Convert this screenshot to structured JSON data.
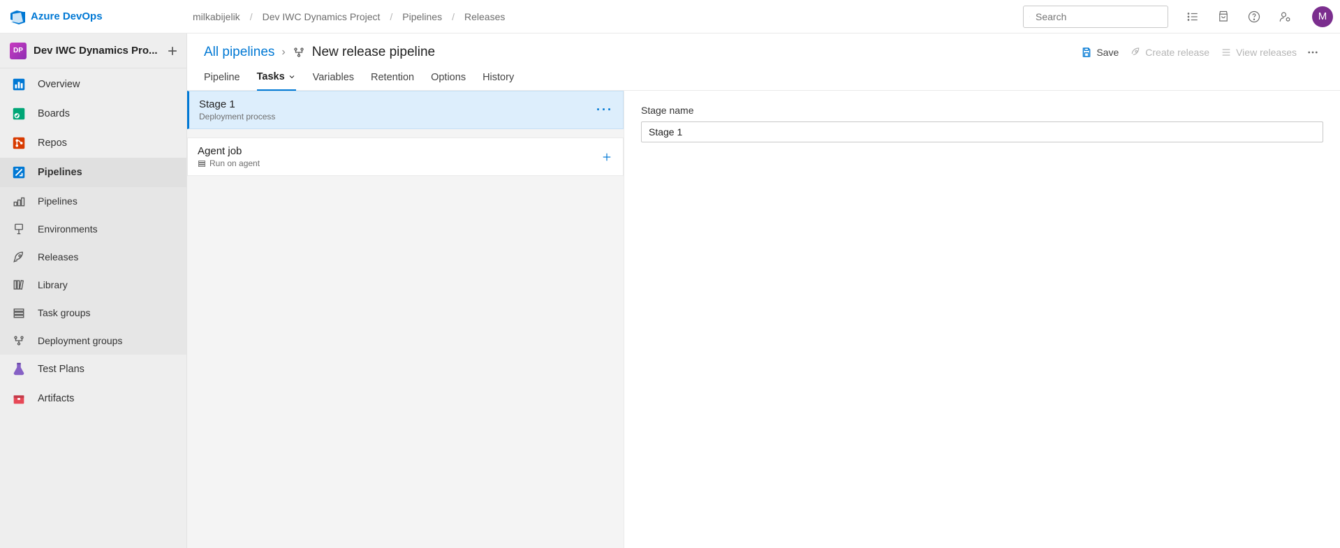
{
  "brand": "Azure DevOps",
  "breadcrumb": [
    "milkabijelik",
    "Dev IWC Dynamics Project",
    "Pipelines",
    "Releases"
  ],
  "search_placeholder": "Search",
  "avatar_initial": "M",
  "project": {
    "badge": "DP",
    "name": "Dev IWC Dynamics Pro..."
  },
  "sidebar": {
    "items": [
      {
        "label": "Overview"
      },
      {
        "label": "Boards"
      },
      {
        "label": "Repos"
      },
      {
        "label": "Pipelines"
      },
      {
        "label": "Test Plans"
      },
      {
        "label": "Artifacts"
      }
    ],
    "sub": [
      {
        "label": "Pipelines"
      },
      {
        "label": "Environments"
      },
      {
        "label": "Releases"
      },
      {
        "label": "Library"
      },
      {
        "label": "Task groups"
      },
      {
        "label": "Deployment groups"
      }
    ]
  },
  "page": {
    "crumb_link": "All pipelines",
    "title": "New release pipeline",
    "actions": {
      "save": "Save",
      "create_release": "Create release",
      "view_releases": "View releases"
    },
    "tabs": [
      "Pipeline",
      "Tasks",
      "Variables",
      "Retention",
      "Options",
      "History"
    ]
  },
  "stage": {
    "name": "Stage 1",
    "subtitle": "Deployment process"
  },
  "job": {
    "name": "Agent job",
    "subtitle": "Run on agent"
  },
  "detail": {
    "label": "Stage name",
    "value": "Stage 1"
  }
}
